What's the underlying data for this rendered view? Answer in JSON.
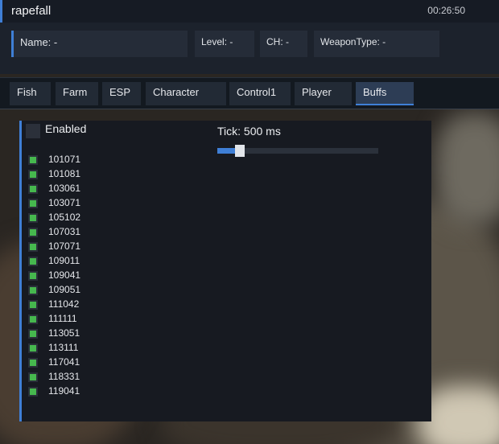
{
  "header": {
    "title": "rapefall",
    "clock": "00:26:50"
  },
  "info": {
    "name": "Name: -",
    "level": "Level: -",
    "ch": "CH: -",
    "weapon_type": "WeaponType: -"
  },
  "tabs": [
    {
      "label": "Fish"
    },
    {
      "label": "Farm"
    },
    {
      "label": "ESP"
    },
    {
      "label": "Character"
    },
    {
      "label": "Control1"
    },
    {
      "label": "Player"
    },
    {
      "label": "Buffs"
    }
  ],
  "active_tab": "Buffs",
  "buffs_panel": {
    "enabled_label": "Enabled",
    "enabled": false,
    "tick_label": "Tick: 500 ms",
    "tick_slider_fraction": 0.1,
    "buffs": [
      {
        "id": "101071",
        "checked": true
      },
      {
        "id": "101081",
        "checked": true
      },
      {
        "id": "103061",
        "checked": true
      },
      {
        "id": "103071",
        "checked": true
      },
      {
        "id": "105102",
        "checked": true
      },
      {
        "id": "107031",
        "checked": true
      },
      {
        "id": "107071",
        "checked": true
      },
      {
        "id": "109011",
        "checked": true
      },
      {
        "id": "109041",
        "checked": true
      },
      {
        "id": "109051",
        "checked": true
      },
      {
        "id": "111042",
        "checked": true
      },
      {
        "id": "111111",
        "checked": true
      },
      {
        "id": "113051",
        "checked": true
      },
      {
        "id": "113111",
        "checked": true
      },
      {
        "id": "117041",
        "checked": true
      },
      {
        "id": "118331",
        "checked": true
      },
      {
        "id": "119041",
        "checked": true
      }
    ]
  },
  "colors": {
    "accent": "#3f7fd6",
    "check_on": "#46b84e",
    "panel_bg": "#171a21"
  }
}
